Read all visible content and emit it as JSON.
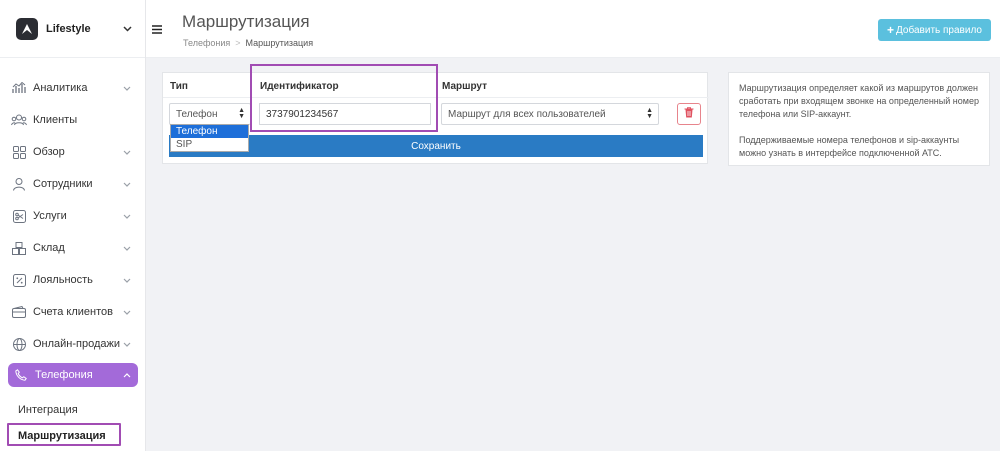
{
  "brand": {
    "name": "Lifestyle"
  },
  "sidebar": {
    "items": [
      {
        "label": "Аналитика",
        "icon": "analytics-icon"
      },
      {
        "label": "Клиенты",
        "icon": "clients-icon"
      },
      {
        "label": "Обзор",
        "icon": "grid-icon"
      },
      {
        "label": "Сотрудники",
        "icon": "user-icon"
      },
      {
        "label": "Услуги",
        "icon": "scissors-icon"
      },
      {
        "label": "Склад",
        "icon": "boxes-icon"
      },
      {
        "label": "Лояльность",
        "icon": "percent-icon"
      },
      {
        "label": "Счета клиентов",
        "icon": "wallet-icon"
      },
      {
        "label": "Онлайн-продажи",
        "icon": "globe-icon"
      },
      {
        "label": "Телефония",
        "icon": "phone-icon",
        "active": true
      }
    ],
    "sub_items": [
      {
        "label": "Интеграция"
      },
      {
        "label": "Маршрутизация",
        "current": true
      }
    ]
  },
  "header": {
    "title": "Маршрутизация",
    "breadcrumb": [
      "Телефония",
      "Маршрутизация"
    ],
    "add_button": "Добавить правило"
  },
  "table": {
    "columns": [
      "Тип",
      "Идентификатор",
      "Маршрут"
    ],
    "row": {
      "type": "Телефон",
      "identifier": "3737901234567",
      "route": "Маршрут для всех пользователей"
    },
    "type_options": [
      "Телефон",
      "SIP"
    ],
    "selected_type_option": "Телефон",
    "save_button": "Сохранить"
  },
  "info": {
    "paragraphs": [
      "Маршрутизация определяет какой из маршрутов должен сработать при входящем звонке на определенный номер телефона или SIP-аккаунт.",
      "Поддерживаемые номера телефонов и sip-аккаунты можно узнать в интерфейсе подключенной АТС."
    ]
  },
  "colors": {
    "accent": "#a36ad9",
    "highlight_box": "#a14cb3",
    "primary_button": "#2a7bc4",
    "add_button": "#5bc0de",
    "danger": "#e05260"
  }
}
